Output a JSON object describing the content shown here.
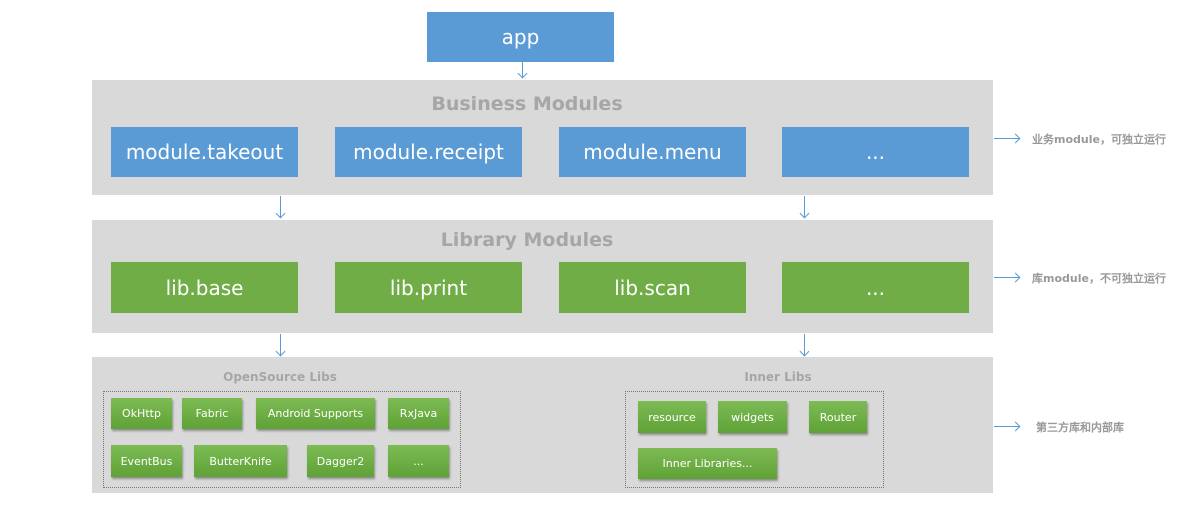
{
  "app": {
    "label": "app"
  },
  "business": {
    "title": "Business Modules",
    "modules": [
      "module.takeout",
      "module.receipt",
      "module.menu",
      "..."
    ],
    "note": "业务module，可独立运行"
  },
  "library": {
    "title": "Library Modules",
    "modules": [
      "lib.base",
      "lib.print",
      "lib.scan",
      "..."
    ],
    "note": "库module，不可独立运行"
  },
  "libs": {
    "note": "第三方库和内部库",
    "opensource": {
      "title": "OpenSource Libs",
      "items": [
        "OkHttp",
        "Fabric",
        "Android Supports",
        "RxJava",
        "EventBus",
        "ButterKnife",
        "Dagger2",
        "..."
      ]
    },
    "inner": {
      "title": "Inner Libs",
      "items": [
        "resource",
        "widgets",
        "Router",
        "Inner Libraries..."
      ]
    }
  },
  "colors": {
    "business": "#5b9bd5",
    "library": "#70ad47",
    "panel": "#d9d9d9",
    "arrow": "#5b9bd5"
  }
}
